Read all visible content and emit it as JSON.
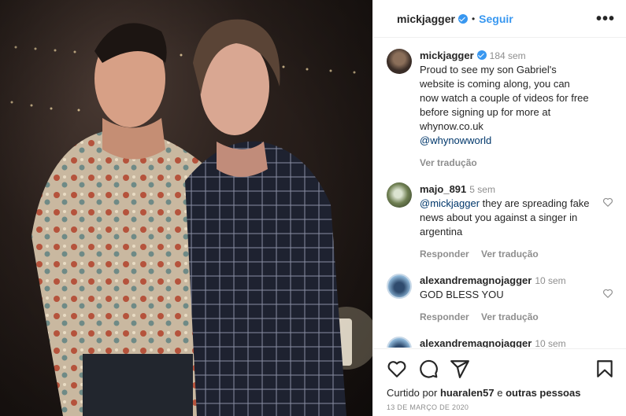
{
  "header": {
    "username": "mickjagger",
    "dot": "•",
    "follow_label": "Seguir",
    "more_label": "•••"
  },
  "caption": {
    "username": "mickjagger",
    "time": "184 sem",
    "text": "Proud to see my son Gabriel's website is coming along, you can now watch a couple of videos for free before signing up for more at whynow.co.uk",
    "mention": "@whynowworld",
    "translate_label": "Ver tradução"
  },
  "comments": [
    {
      "username": "majo_891",
      "time": "5 sem",
      "mention": "@mickjagger",
      "text": " they are spreading fake news about you against a singer in argentina",
      "reply_label": "Responder",
      "translate_label": "Ver tradução"
    },
    {
      "username": "alexandremagnojagger",
      "time": "10 sem",
      "text": "GOD BLESS YOU",
      "reply_label": "Responder",
      "translate_label": "Ver tradução"
    },
    {
      "username": "alexandremagnojagger",
      "time": "10 sem",
      "text": "❤"
    }
  ],
  "actions": {
    "liked_by_prefix": "Curtido por",
    "liked_by_user": "huaralen57",
    "liked_by_suffix": "e",
    "liked_by_others": "outras pessoas",
    "date": "13 DE MARÇO DE 2020"
  },
  "colors": {
    "accent": "#3897f0",
    "mention": "#00376b",
    "muted": "#8e8e8e"
  },
  "icons": [
    "verified-badge-icon",
    "more-icon",
    "like-icon",
    "comment-icon",
    "share-icon",
    "bookmark-icon",
    "heart-icon"
  ]
}
